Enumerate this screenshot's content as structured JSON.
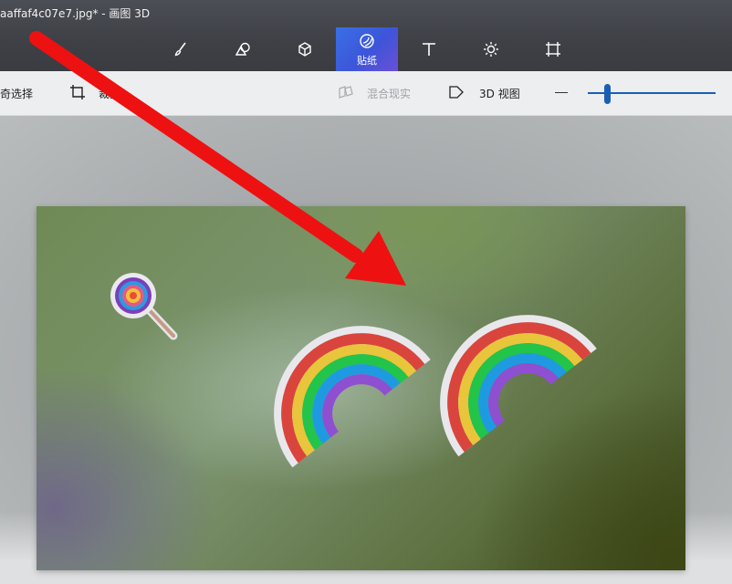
{
  "window": {
    "title": "aaffaf4c07e7.jpg* - 画图 3D"
  },
  "toolbar": {
    "tools": [
      {
        "name": "brushes",
        "icon": "brush-icon"
      },
      {
        "name": "2d-shapes",
        "icon": "2d-shapes-icon"
      },
      {
        "name": "3d-shapes",
        "icon": "cube-icon"
      },
      {
        "name": "stickers",
        "icon": "sticker-icon",
        "label": "贴纸",
        "active": true
      },
      {
        "name": "text",
        "icon": "text-icon"
      },
      {
        "name": "effects",
        "icon": "sun-icon"
      },
      {
        "name": "canvas",
        "icon": "canvas-icon"
      }
    ],
    "active_color": "#3d55d9"
  },
  "subtoolbar": {
    "magic_select_label": "奇选择",
    "crop_label": "裁剪",
    "mixed_reality_label": "混合现实",
    "view3d_label": "3D 视图",
    "zoom_level": 0.15,
    "accent_color": "#1a5fb4"
  },
  "canvas": {
    "stickers": [
      "lollipop-sticker",
      "rainbow-sticker",
      "rainbow-sticker"
    ],
    "annotation": "red-arrow"
  }
}
